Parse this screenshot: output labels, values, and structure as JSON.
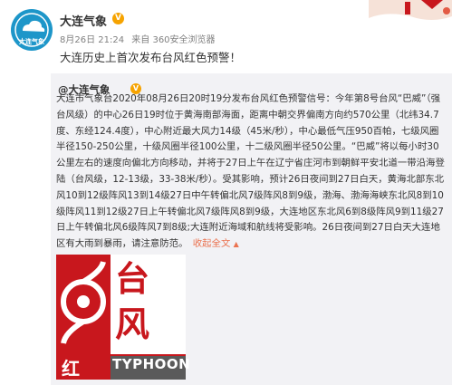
{
  "post": {
    "account_name": "大连气象",
    "avatar_text": "大连气象",
    "date": "8月26日 21:24",
    "via": "来自 360安全浏览器",
    "text": "大连历史上首次发布台风红色预警！"
  },
  "quoted": {
    "user": "@大连气象",
    "body": "大连市气象台2020年08月26日20时19分发布台风红色预警信号：今年第8号台风“巴威”（强台风级）的中心26日19时位于黄海南部海面，距离中朝交界偏南方向约570公里（北纬34.7度、东经124.4度），中心附近最大风力14级（45米/秒），中心最低气压950百帕，七级风圈半径150-250公里，十级风圈半径100公里，十二级风圈半径50公里。“巴威”将以每小时30公里左右的速度向偏北方向移动，并将于27日上午在辽宁省庄河市到朝鲜平安北道一带沿海登陆（台风级，12-13级，33-38米/秒）。受其影响，预计26日夜间到27日白天，黄海北部东北风10到12级阵风13到14级27日中午转偏北风7级阵风8到9级，渤海、渤海海峡东北风8到10级阵风11到12级27日上午转偏北风7级阵风8到9级，大连地区东北风6到8级阵风9到11级27日上午转偏北风6级阵风7到8级;大连附近海域和航线将受影响。26日夜间到27日白天大连地区有大雨到暴雨，请注意防范。",
    "expand_label": "收起全文",
    "expand_icon": "chevron-up-icon"
  },
  "warning_image": {
    "char_top": "台",
    "char_bottom": "风",
    "level_char": "红",
    "label": "TYPHOON",
    "color_red": "#c8171d",
    "color_gray": "#5a5a5a"
  },
  "colors": {
    "avatar_bg": "#1d96c9",
    "verified": "#f6a300",
    "link": "#eb7350",
    "quote_bg": "#f2f2f5"
  }
}
